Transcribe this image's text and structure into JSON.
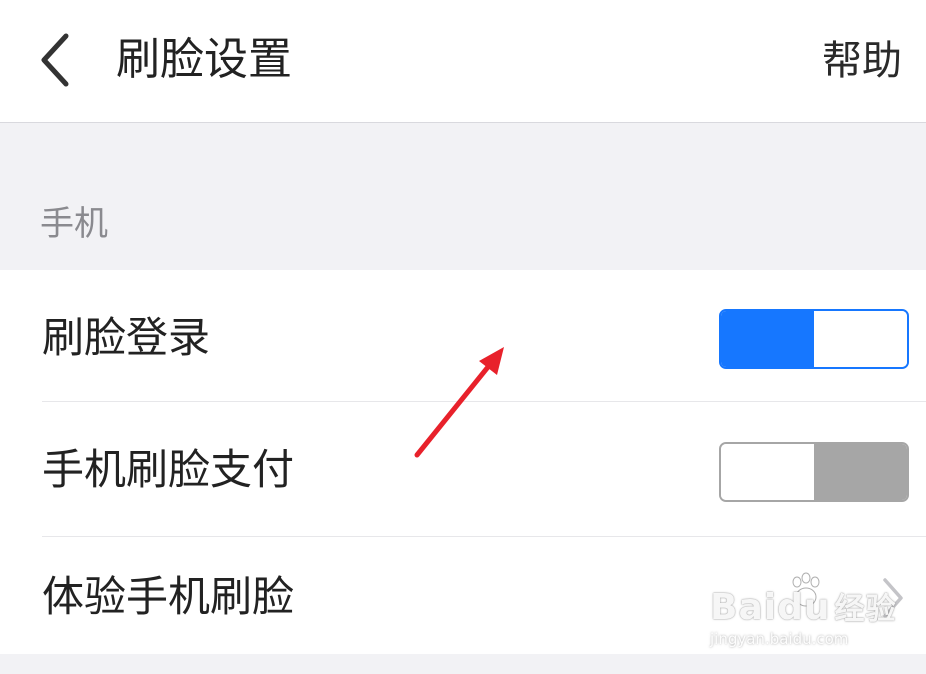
{
  "header": {
    "title": "刷脸设置",
    "help_label": "帮助",
    "back_icon": "chevron-left-icon"
  },
  "section": {
    "label": "手机"
  },
  "rows": [
    {
      "label": "刷脸登录",
      "control": "toggle",
      "on": true
    },
    {
      "label": "手机刷脸支付",
      "control": "toggle",
      "on": false
    },
    {
      "label": "体验手机刷脸",
      "control": "chevron",
      "icon": "chevron-right-icon"
    }
  ],
  "watermark": {
    "brand": "Baidu",
    "brand_cn": "经验",
    "url": "jingyan.baidu.com"
  },
  "colors": {
    "accent": "#1677ff",
    "toggle_off": "#a6a6a6",
    "annotation": "#e8212b",
    "background": "#f2f2f5"
  }
}
